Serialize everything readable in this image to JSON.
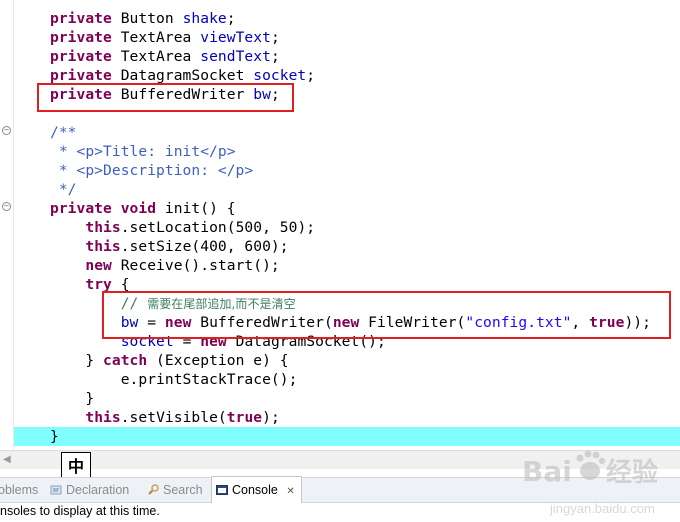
{
  "editor": {
    "lines": [
      {
        "parts": [
          [
            "kw",
            "private"
          ],
          [
            "p",
            " Button "
          ],
          [
            "fld",
            "shake"
          ],
          [
            "p",
            ";"
          ]
        ]
      },
      {
        "parts": [
          [
            "kw",
            "private"
          ],
          [
            "p",
            " TextArea "
          ],
          [
            "fld",
            "viewText"
          ],
          [
            "p",
            ";"
          ]
        ]
      },
      {
        "parts": [
          [
            "kw",
            "private"
          ],
          [
            "p",
            " TextArea "
          ],
          [
            "fld",
            "sendText"
          ],
          [
            "p",
            ";"
          ]
        ]
      },
      {
        "parts": [
          [
            "kw",
            "private"
          ],
          [
            "p",
            " DatagramSocket "
          ],
          [
            "fld",
            "socket"
          ],
          [
            "p",
            ";"
          ]
        ]
      },
      {
        "parts": [
          [
            "kw",
            "private"
          ],
          [
            "p",
            " BufferedWriter "
          ],
          [
            "fld",
            "bw"
          ],
          [
            "p",
            ";"
          ]
        ]
      },
      {
        "parts": []
      },
      {
        "parts": [
          [
            "cmt",
            "/**"
          ]
        ]
      },
      {
        "parts": [
          [
            "cmt",
            " * <p>Title: init</p>"
          ]
        ]
      },
      {
        "parts": [
          [
            "cmt",
            " * <p>Description: </p>"
          ]
        ]
      },
      {
        "parts": [
          [
            "cmt",
            " */"
          ]
        ]
      },
      {
        "parts": [
          [
            "kw",
            "private"
          ],
          [
            "p",
            " "
          ],
          [
            "kw",
            "void"
          ],
          [
            "p",
            " init() {"
          ]
        ]
      },
      {
        "parts": [
          [
            "p",
            "    "
          ],
          [
            "kw",
            "this"
          ],
          [
            "p",
            ".setLocation(500, 50);"
          ]
        ]
      },
      {
        "parts": [
          [
            "p",
            "    "
          ],
          [
            "kw",
            "this"
          ],
          [
            "p",
            ".setSize(400, 600);"
          ]
        ]
      },
      {
        "parts": [
          [
            "p",
            "    "
          ],
          [
            "kw",
            "new"
          ],
          [
            "p",
            " Receive().start();"
          ]
        ]
      },
      {
        "parts": [
          [
            "p",
            "    "
          ],
          [
            "kw",
            "try"
          ],
          [
            "p",
            " {"
          ]
        ]
      },
      {
        "parts": [
          [
            "lcm",
            "        // "
          ],
          [
            "lcmcn",
            "需要在尾部追加,而不是清空"
          ]
        ]
      },
      {
        "parts": [
          [
            "p",
            "        "
          ],
          [
            "fld",
            "bw"
          ],
          [
            "p",
            " = "
          ],
          [
            "kw",
            "new"
          ],
          [
            "p",
            " BufferedWriter("
          ],
          [
            "kw",
            "new"
          ],
          [
            "p",
            " FileWriter("
          ],
          [
            "str",
            "\"config.txt\""
          ],
          [
            "p",
            ", "
          ],
          [
            "kw",
            "true"
          ],
          [
            "p",
            "));"
          ]
        ]
      },
      {
        "parts": [
          [
            "p",
            "        "
          ],
          [
            "fld",
            "socket"
          ],
          [
            "p",
            " = "
          ],
          [
            "kw",
            "new"
          ],
          [
            "p",
            " DatagramSocket();"
          ]
        ]
      },
      {
        "parts": [
          [
            "p",
            "    } "
          ],
          [
            "kw",
            "catch"
          ],
          [
            "p",
            " (Exception e) {"
          ]
        ]
      },
      {
        "parts": [
          [
            "p",
            "        e.printStackTrace();"
          ]
        ]
      },
      {
        "parts": [
          [
            "p",
            "    }"
          ]
        ]
      },
      {
        "parts": [
          [
            "p",
            "    "
          ],
          [
            "kw",
            "this"
          ],
          [
            "p",
            ".setVisible("
          ],
          [
            "kw",
            "true"
          ],
          [
            "p",
            ");"
          ]
        ]
      },
      {
        "parts": [
          [
            "p",
            "}"
          ]
        ]
      }
    ]
  },
  "ime_indicator": "中",
  "tabs": [
    {
      "label": "oblems",
      "icon": "problems-icon"
    },
    {
      "label": "Declaration",
      "icon": "declaration-icon"
    },
    {
      "label": "Search",
      "icon": "search-icon"
    },
    {
      "label": "Console",
      "icon": "console-icon",
      "active": true,
      "close": "✕"
    }
  ],
  "status": "nsoles to display at this time.",
  "watermark": {
    "brand": "Bai",
    "brand2": "经验",
    "url": "jingyan.baidu.com"
  },
  "colors": {
    "keyword": "#7f0055",
    "field": "#0000c0",
    "javadoc": "#3f5fbf",
    "comment": "#3f7f5f",
    "string": "#2a00ff",
    "current_line": "#80ffff",
    "highlight_box": "#e02020"
  }
}
